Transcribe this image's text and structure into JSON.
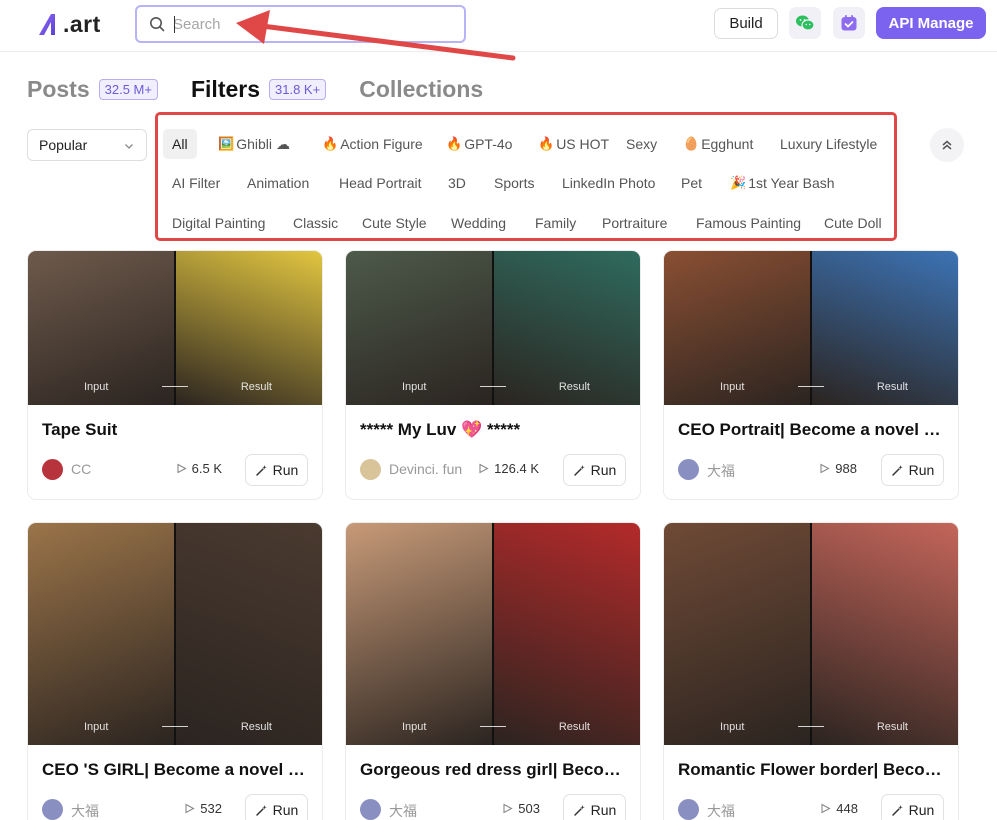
{
  "header": {
    "logo_text": ".art",
    "search_placeholder": "Search",
    "build_label": "Build",
    "api_label": "API Manage"
  },
  "tabs": [
    {
      "label": "Posts",
      "count": "32.5 M+",
      "active": false
    },
    {
      "label": "Filters",
      "count": "31.8 K+",
      "active": true
    },
    {
      "label": "Collections",
      "active": false
    }
  ],
  "sort": {
    "selected": "Popular"
  },
  "filters": [
    {
      "label": "All",
      "active": true
    },
    {
      "label": "Ghibli",
      "emoji": "🖼️",
      "suffix": "☁"
    },
    {
      "label": "Action Figure",
      "emoji": "🔥"
    },
    {
      "label": "GPT-4o",
      "emoji": "🔥"
    },
    {
      "label": "US HOT",
      "emoji": "🔥"
    },
    {
      "label": "Sexy"
    },
    {
      "label": "Egghunt",
      "emoji": "🥚"
    },
    {
      "label": "Luxury Lifestyle"
    },
    {
      "label": "AI Filter"
    },
    {
      "label": "Animation"
    },
    {
      "label": "Head Portrait"
    },
    {
      "label": "3D"
    },
    {
      "label": "Sports"
    },
    {
      "label": "LinkedIn Photo"
    },
    {
      "label": "Pet"
    },
    {
      "label": "1st Year Bash",
      "emoji": "🎉"
    },
    {
      "label": "Digital Painting"
    },
    {
      "label": "Classic"
    },
    {
      "label": "Cute Style"
    },
    {
      "label": "Wedding"
    },
    {
      "label": "Family"
    },
    {
      "label": "Portraiture"
    },
    {
      "label": "Famous Painting"
    },
    {
      "label": "Cute Doll"
    }
  ],
  "cards": [
    {
      "title": "Tape Suit",
      "author": "CC",
      "plays": "6.5 K",
      "input_label": "Input",
      "result_label": "Result",
      "run_label": "Run",
      "colors": [
        "#6e5a4c",
        "#e2c640"
      ],
      "avatar": "#b8343c"
    },
    {
      "title": "***** My Luv 💖 *****",
      "author": "Devinci. fun",
      "plays": "126.4 K",
      "input_label": "Input",
      "result_label": "Result",
      "run_label": "Run",
      "colors": [
        "#4d5a4a",
        "#2f6b5e"
      ],
      "avatar": "#d9c49a"
    },
    {
      "title": "CEO Portrait| Become a novel protagonist",
      "author": "大福",
      "plays": "988",
      "input_label": "Input",
      "result_label": "Result",
      "run_label": "Run",
      "colors": [
        "#8a4f33",
        "#3c73b5"
      ],
      "avatar": "#8a8fc2"
    },
    {
      "title": "CEO 'S GIRL| Become a novel heroine",
      "author": "大福",
      "plays": "532",
      "input_label": "Input",
      "result_label": "Result",
      "run_label": "Run",
      "colors": [
        "#9b7449",
        "#4a3a30"
      ],
      "avatar": "#8a8fc2"
    },
    {
      "title": "Gorgeous red dress girl| Become a novel heroine",
      "author": "大福",
      "plays": "503",
      "input_label": "Input",
      "result_label": "Result",
      "run_label": "Run",
      "colors": [
        "#c79a78",
        "#b42a2a"
      ],
      "avatar": "#8a8fc2"
    },
    {
      "title": "Romantic Flower border| Become a novel hero",
      "author": "大福",
      "plays": "448",
      "input_label": "Input",
      "result_label": "Result",
      "run_label": "Run",
      "colors": [
        "#6f4a36",
        "#c4655a"
      ],
      "avatar": "#8a8fc2"
    }
  ]
}
